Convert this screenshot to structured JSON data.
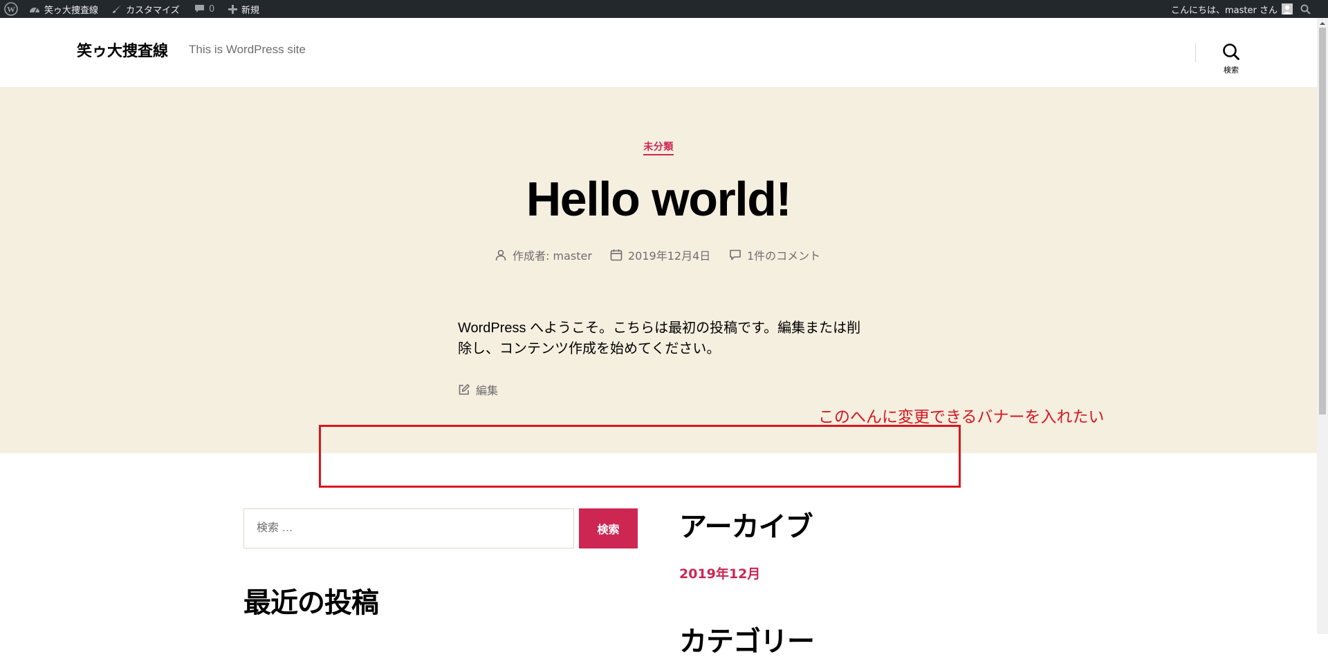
{
  "admin_bar": {
    "site_name": "笑ゥ大捜査線",
    "customize": "カスタマイズ",
    "comments_count": "0",
    "new_label": "新規",
    "greeting": "こんにちは、master さん"
  },
  "header": {
    "site_title": "笑ゥ大捜査線",
    "site_description": "This is WordPress site",
    "search_label": "検索"
  },
  "post": {
    "category": "未分類",
    "title": "Hello world!",
    "author": "作成者: master",
    "date": "2019年12月4日",
    "comments": "1件のコメント",
    "body": "WordPress へようこそ。こちらは最初の投稿です。編集または削除し、コンテンツ作成を始めてください。",
    "edit_label": "編集"
  },
  "annotation": {
    "text": "このへんに変更できるバナーを入れたい",
    "color": "#d9141e"
  },
  "widgets": {
    "search_placeholder": "検索 …",
    "search_button": "検索",
    "recent_posts_title": "最近の投稿",
    "archives_title": "アーカイブ",
    "archive_month": "2019年12月",
    "categories_title": "カテゴリー"
  },
  "colors": {
    "accent": "#cd2653",
    "hero_bg": "#f5efe0",
    "admin_bar_bg": "#23282d"
  }
}
